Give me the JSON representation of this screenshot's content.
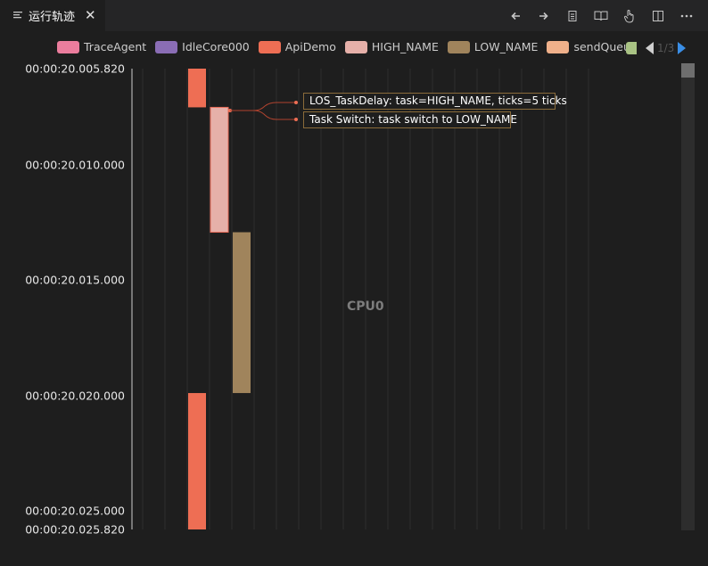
{
  "tab": {
    "title": "运行轨迹",
    "close": "✕"
  },
  "toolbar": {
    "buttons": [
      "back-arrow-icon",
      "forward-arrow-icon",
      "document-icon",
      "book-icon",
      "hand-pointer-icon",
      "split-view-icon",
      "more-icon"
    ]
  },
  "legend": {
    "items": [
      {
        "label": "TraceAgent",
        "color": "#eb7d9d"
      },
      {
        "label": "IdleCore000",
        "color": "#8a6db5"
      },
      {
        "label": "ApiDemo",
        "color": "#ee6e54"
      },
      {
        "label": "HIGH_NAME",
        "color": "#e6b0a9"
      },
      {
        "label": "LOW_NAME",
        "color": "#a0845c"
      },
      {
        "label": "sendQueue",
        "color": "#efb08a"
      }
    ],
    "page": "1/3",
    "next_color": "#a9c384"
  },
  "timeline": {
    "time_labels": [
      "00:00:20.005.820",
      "00:00:20.010.000",
      "00:00:20.015.000",
      "00:00:20.020.000",
      "00:00:20.025.000",
      "00:00:20.025.820"
    ],
    "cpu_label": "CPU0",
    "bars": [
      {
        "task": "ApiDemo",
        "start": 20.00582,
        "end": 20.0075,
        "color": "#ee6e54"
      },
      {
        "task": "HIGH_NAME",
        "start": 20.0075,
        "end": 20.01292,
        "color": "#e6b0a9"
      },
      {
        "task": "LOW_NAME",
        "start": 20.01292,
        "end": 20.0199,
        "color": "#a0845c"
      },
      {
        "task": "ApiDemo",
        "start": 20.0199,
        "end": 20.02582,
        "color": "#ee6e54"
      }
    ]
  },
  "events": [
    {
      "text": "LOS_TaskDelay: task=HIGH_NAME, ticks=5 ticks"
    },
    {
      "text": "Task Switch: task switch to LOW_NAME"
    }
  ]
}
